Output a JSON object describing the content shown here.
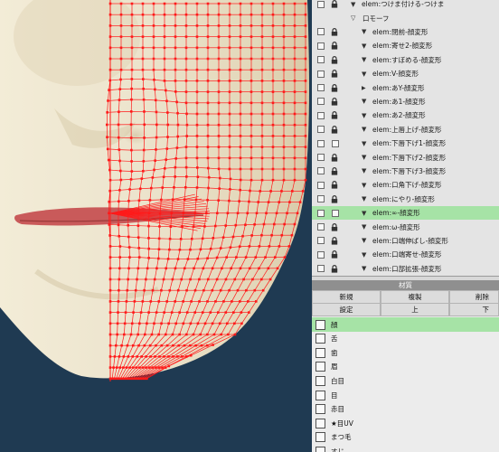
{
  "colors": {
    "viewport_bg": "#1f3a52",
    "skin": "#ebe3cc",
    "wire": "#ff1a1a",
    "lip": "#c95a5a",
    "selected_row": "#a6e3a6"
  },
  "layers": [
    {
      "label": "elem:つけま付ける-つけま",
      "arrow": "down",
      "indent": 0,
      "lock": "lock",
      "selected": false
    },
    {
      "label": "口モーフ",
      "arrow": "down-outline",
      "indent": -1,
      "lock": "none",
      "selected": false,
      "folder": true
    },
    {
      "label": "elem:閉前-顔変形",
      "arrow": "down",
      "indent": 1,
      "lock": "lock",
      "selected": false
    },
    {
      "label": "elem:寄せ2-顔変形",
      "arrow": "down",
      "indent": 1,
      "lock": "lock",
      "selected": false
    },
    {
      "label": "elem:すぼめる-顔変形",
      "arrow": "down",
      "indent": 1,
      "lock": "lock",
      "selected": false
    },
    {
      "label": "elem:V-顔変形",
      "arrow": "down",
      "indent": 1,
      "lock": "lock",
      "selected": false
    },
    {
      "label": "elem:あY-顔変形",
      "arrow": "right",
      "indent": 1,
      "lock": "lock",
      "selected": false
    },
    {
      "label": "elem:あ1-顔変形",
      "arrow": "down",
      "indent": 1,
      "lock": "lock",
      "selected": false
    },
    {
      "label": "elem:あ2-顔変形",
      "arrow": "down",
      "indent": 1,
      "lock": "lock",
      "selected": false
    },
    {
      "label": "elem:上唇上げ-顔変形",
      "arrow": "down",
      "indent": 1,
      "lock": "lock",
      "selected": false
    },
    {
      "label": "elem:下唇下げ1-顔変形",
      "arrow": "down",
      "indent": 1,
      "lock": "box",
      "selected": false
    },
    {
      "label": "elem:下唇下げ2-顔変形",
      "arrow": "down",
      "indent": 1,
      "lock": "lock",
      "selected": false
    },
    {
      "label": "elem:下唇下げ3-顔変形",
      "arrow": "down",
      "indent": 1,
      "lock": "lock",
      "selected": false
    },
    {
      "label": "elem:口角下げ-顔変形",
      "arrow": "down",
      "indent": 1,
      "lock": "lock",
      "selected": false
    },
    {
      "label": "elem:にやり-顔変形",
      "arrow": "down",
      "indent": 1,
      "lock": "lock",
      "selected": false
    },
    {
      "label": "elem:∞-顔変形",
      "arrow": "down",
      "indent": 1,
      "lock": "box",
      "selected": true,
      "eye": true
    },
    {
      "label": "elem:ω-顔変形",
      "arrow": "down",
      "indent": 1,
      "lock": "lock",
      "selected": false
    },
    {
      "label": "elem:口端伸ばし-顔変形",
      "arrow": "down",
      "indent": 1,
      "lock": "lock",
      "selected": false
    },
    {
      "label": "elem:口端寄せ-顔変形",
      "arrow": "down",
      "indent": 1,
      "lock": "lock",
      "selected": false
    },
    {
      "label": "elem:口部拡張-顔変形",
      "arrow": "down",
      "indent": 1,
      "lock": "lock",
      "selected": false
    }
  ],
  "material": {
    "header": "材質",
    "buttons": {
      "new": "新規",
      "copy": "複製",
      "delete": "削除",
      "settings": "設定",
      "up": "上",
      "down": "下"
    },
    "items": [
      "顔",
      "舌",
      "歯",
      "眉",
      "白目",
      "目",
      "赤目",
      "★目UV",
      "まつ毛",
      "すじ"
    ],
    "selected_index": 0
  }
}
